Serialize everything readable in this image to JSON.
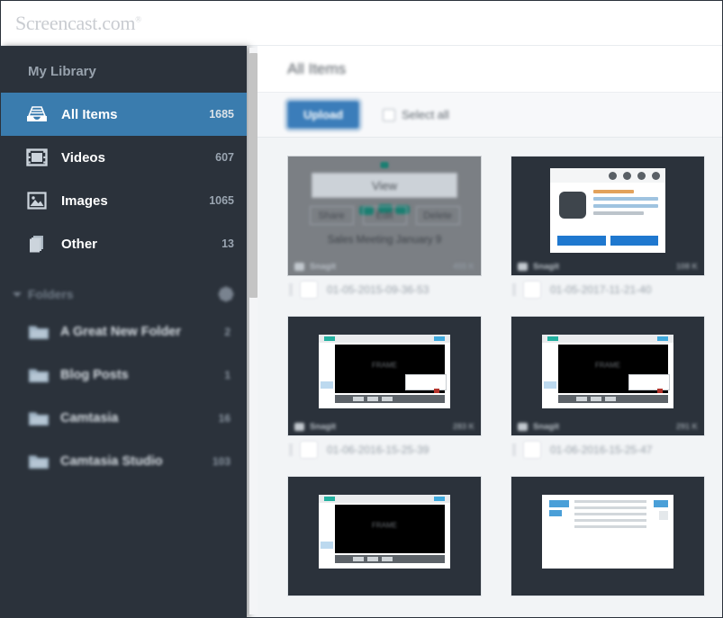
{
  "app": {
    "logo": "Screencast.com",
    "logo_tm": "®"
  },
  "sidebar": {
    "title": "My Library",
    "nav": [
      {
        "label": "All Items",
        "count": "1685",
        "icon": "inbox-icon",
        "active": true
      },
      {
        "label": "Videos",
        "count": "607",
        "icon": "film-icon",
        "active": false
      },
      {
        "label": "Images",
        "count": "1065",
        "icon": "image-icon",
        "active": false
      },
      {
        "label": "Other",
        "count": "13",
        "icon": "files-icon",
        "active": false
      }
    ],
    "folders_header": {
      "label": "Folders",
      "chevron_icon": "chevron-down-icon",
      "gear_icon": "gear-icon"
    },
    "folders": [
      {
        "label": "A Great New Folder",
        "count": "2"
      },
      {
        "label": "Blog Posts",
        "count": "1"
      },
      {
        "label": "Camtasia",
        "count": "16"
      },
      {
        "label": "Camtasia Studio",
        "count": "103"
      }
    ]
  },
  "main": {
    "title": "All Items",
    "toolbar": {
      "upload_label": "Upload",
      "select_all_label": "Select all"
    },
    "cards": [
      {
        "caption": "01-05-2015-09-36-53",
        "badge_label": "Snagit",
        "badge_size": "455 K",
        "thumb_kind": "hover",
        "hovered": true,
        "overlay": {
          "view_label": "View",
          "share_label": "Share",
          "edit_label": "Edit",
          "delete_label": "Delete",
          "title": "Sales Meeting January 9"
        }
      },
      {
        "caption": "01-05-2017-11-21-40",
        "badge_label": "Snagit",
        "badge_size": "108 K",
        "thumb_kind": "dialog",
        "hovered": false
      },
      {
        "caption": "01-06-2016-15-25-39",
        "badge_label": "Snagit",
        "badge_size": "283 K",
        "thumb_kind": "video",
        "hovered": false,
        "video_label": "FRAME"
      },
      {
        "caption": "01-06-2016-15-25-47",
        "badge_label": "Snagit",
        "badge_size": "291 K",
        "thumb_kind": "video",
        "hovered": false,
        "video_label": "FRAME"
      },
      {
        "caption": "",
        "badge_label": "",
        "badge_size": "",
        "thumb_kind": "video",
        "hovered": false,
        "video_label": "FRAME"
      },
      {
        "caption": "",
        "badge_label": "",
        "badge_size": "",
        "thumb_kind": "doc",
        "hovered": false
      }
    ]
  },
  "colors": {
    "sidebar_bg": "#2b323b",
    "active_blue": "#3a7cae",
    "upload_blue": "#3b7dba",
    "page_bg": "#f2f4f6",
    "thumb_bg": "#2b323b"
  }
}
